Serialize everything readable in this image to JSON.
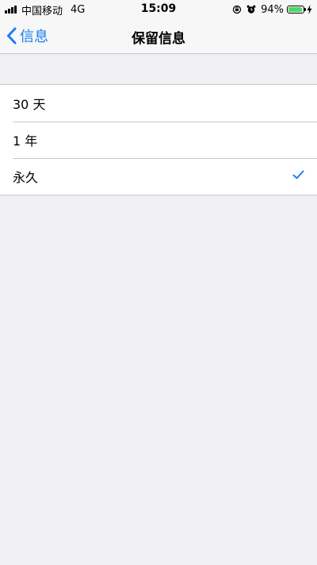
{
  "status_bar": {
    "carrier": "中国移动",
    "network": "4G",
    "time": "15:09",
    "battery_percent_text": "94%",
    "battery_level": 0.94,
    "icons": [
      "signal-icon",
      "orientation-lock-icon",
      "alarm-icon",
      "battery-icon",
      "charging-bolt-icon"
    ]
  },
  "nav": {
    "back_label": "信息",
    "title": "保留信息"
  },
  "options": [
    {
      "label": "30 天",
      "selected": false
    },
    {
      "label": "1 年",
      "selected": false
    },
    {
      "label": "永久",
      "selected": true
    }
  ],
  "colors": {
    "accent": "#1a7ef2",
    "background": "#efeff4",
    "battery_fill": "#4cd964"
  }
}
